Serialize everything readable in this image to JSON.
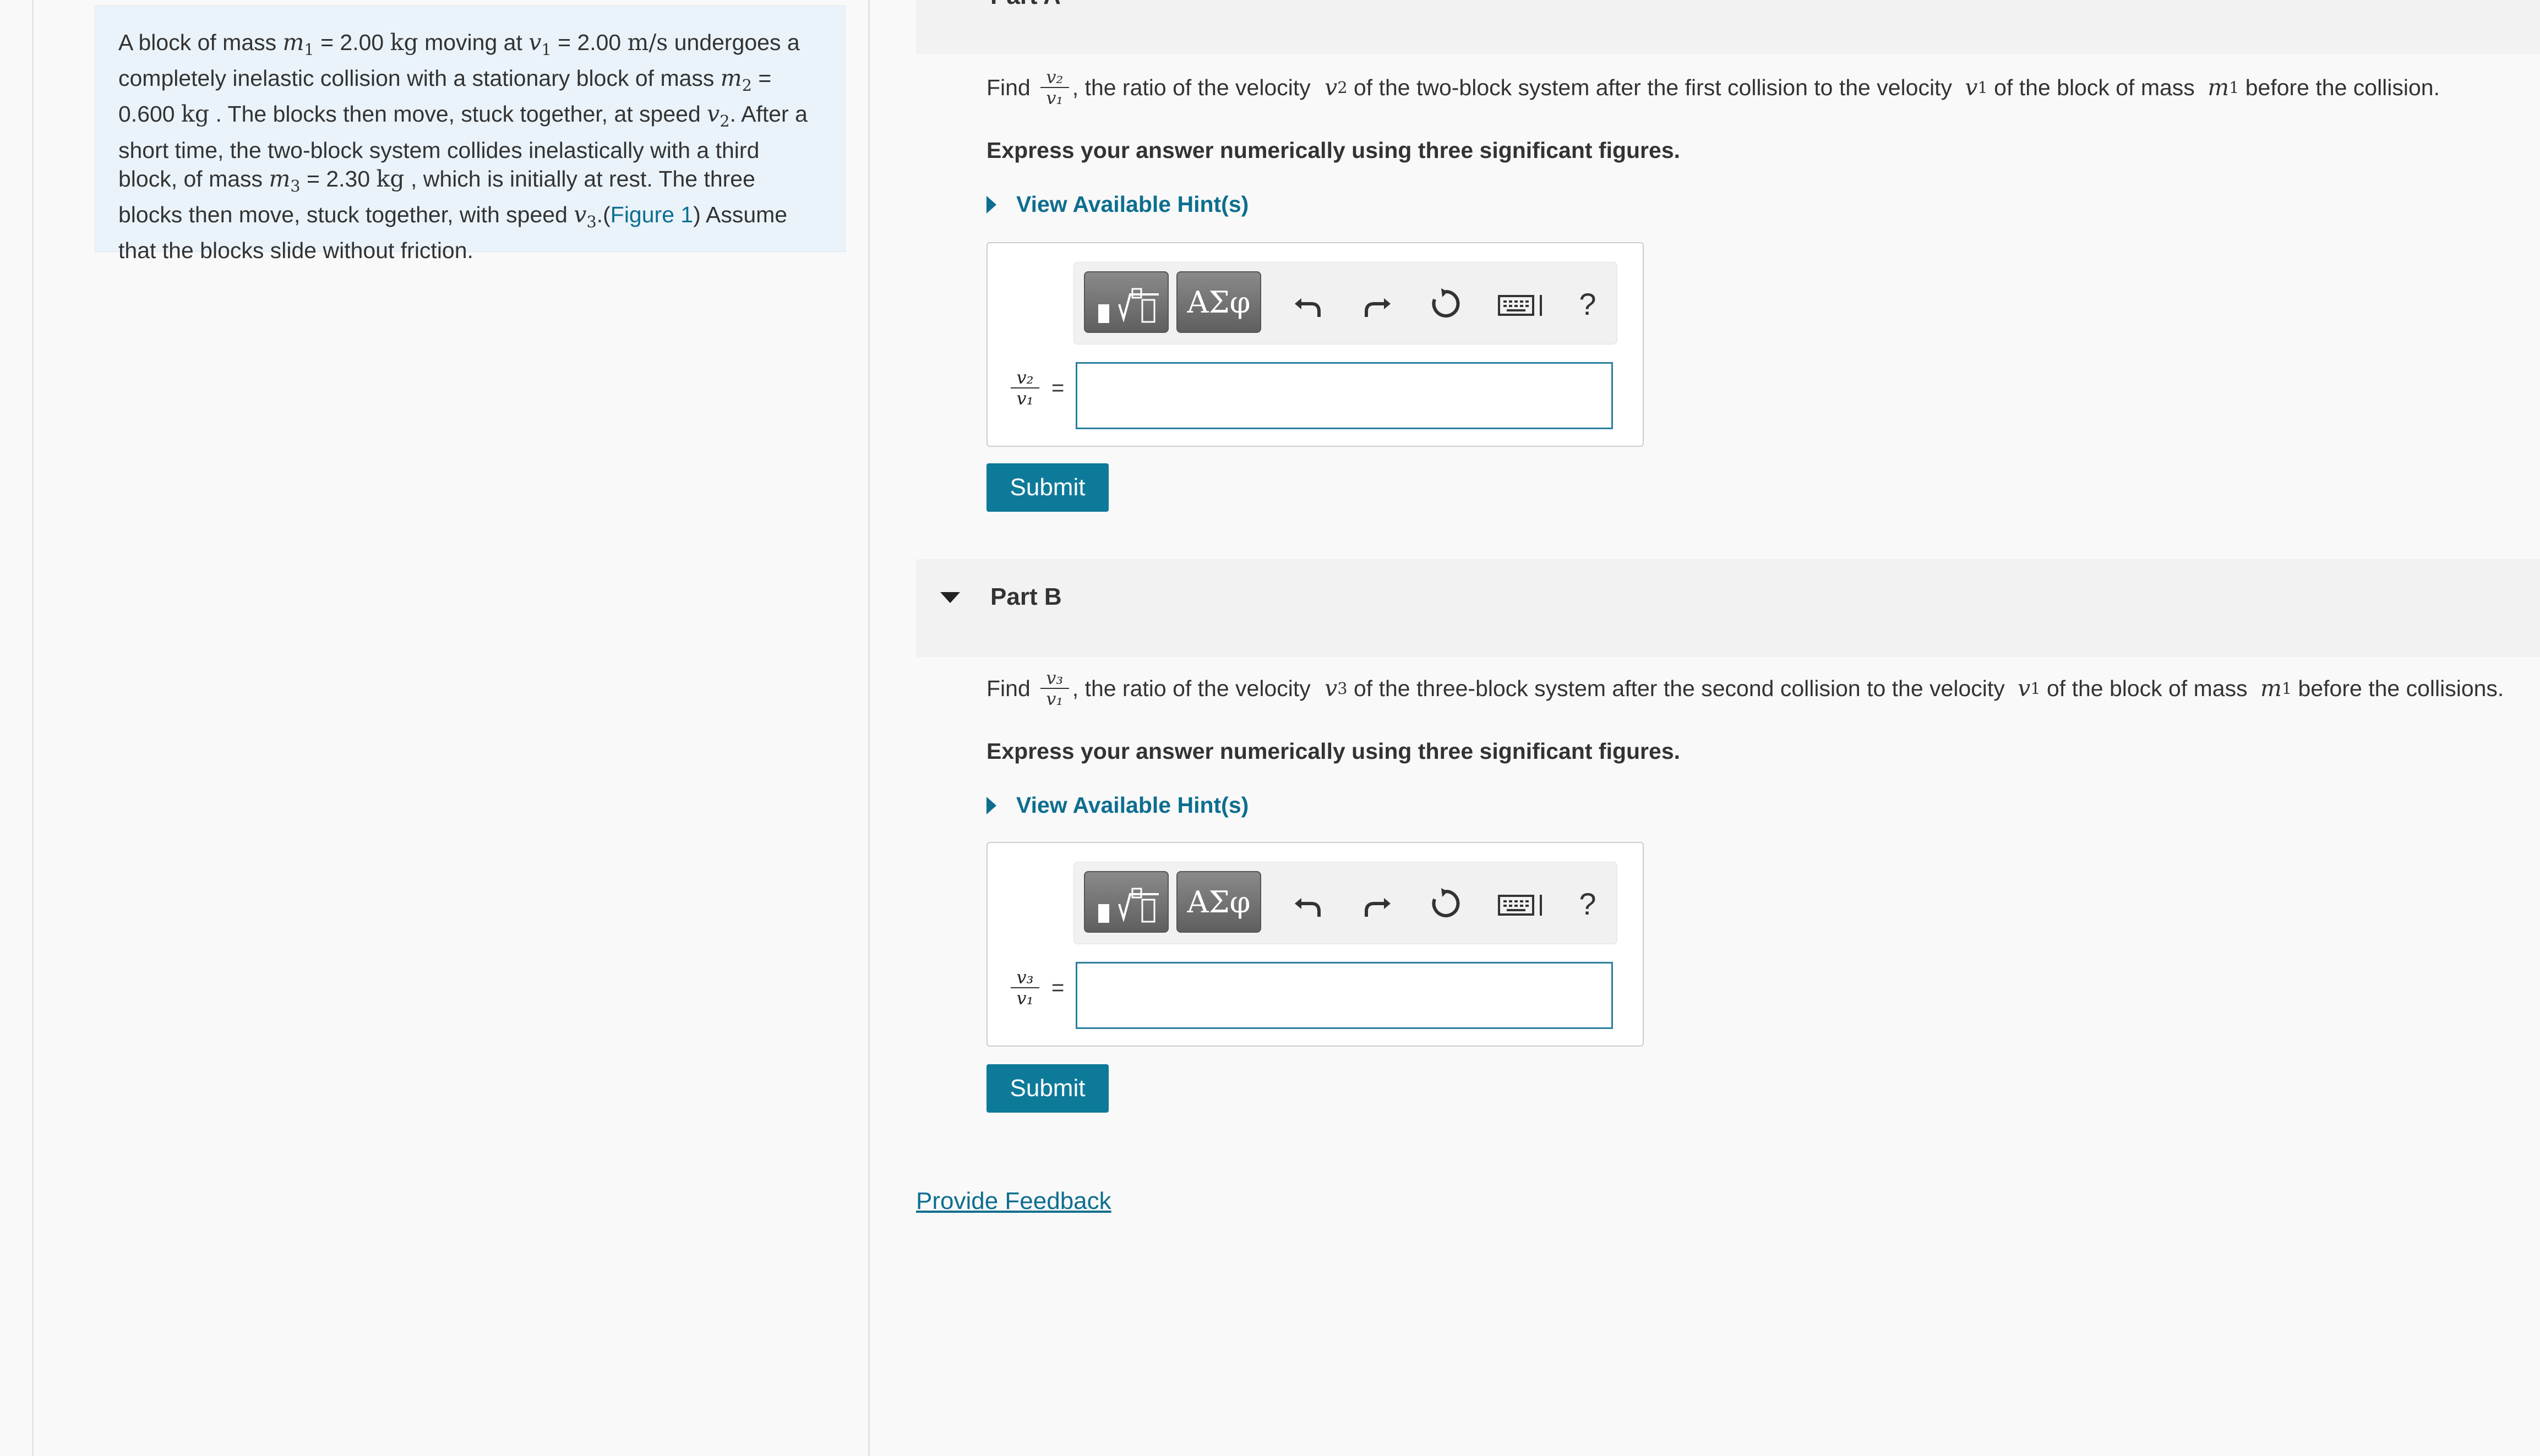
{
  "problem": {
    "t1": "A block of mass ",
    "m1": "m",
    "m1_sub": "1",
    "t2": " = 2.00 ",
    "kg1": "kg",
    "t3": " moving at ",
    "v1": "v",
    "v1_sub": "1",
    "t4": " = 2.00 ",
    "ms": "m/s",
    "t5": " undergoes a completely inelastic collision with a stationary block of mass ",
    "m2": "m",
    "m2_sub": "2",
    "t6": " = 0.600 ",
    "kg2": "kg",
    "t7": " . The blocks then move, stuck together, at speed ",
    "v2": "v",
    "v2_sub": "2",
    "t8": ". After a short time, the two-block system collides inelastically with a third block, of mass ",
    "m3": "m",
    "m3_sub": "3",
    "t9": " = 2.30 ",
    "kg3": "kg",
    "t10": " , which is initially at rest. The three blocks then move, stuck together, with speed ",
    "v3": "v",
    "v3_sub": "3",
    "t11": ".(",
    "figure_link": "Figure 1",
    "t12": ") Assume that the blocks slide without friction."
  },
  "parts": [
    {
      "title": "Part A",
      "question": {
        "find": "Find",
        "frac_num": "v₂",
        "frac_den": "v₁",
        "before": ", the ratio of the velocity ",
        "var1": "v",
        "var1_sub": "2",
        "mid": " of the two-block system after the first collision to the velocity ",
        "var2": "v",
        "var2_sub": "1",
        "mid2": " of the block of mass ",
        "var3": "m",
        "var3_sub": "1",
        "end": " before the collision."
      },
      "instruction": "Express your answer numerically using three significant figures.",
      "hint_label": "View Available Hint(s)",
      "lhs_num": "v₂",
      "lhs_den": "v₁",
      "equals": "=",
      "input_value": "",
      "submit_label": "Submit"
    },
    {
      "title": "Part B",
      "question": {
        "find": "Find",
        "frac_num": "v₃",
        "frac_den": "v₁",
        "before": ", the ratio of the velocity ",
        "var1": "v",
        "var1_sub": "3",
        "mid": " of the three-block system after the second collision to the velocity ",
        "var2": "v",
        "var2_sub": "1",
        "mid2": " of the block of mass ",
        "var3": "m",
        "var3_sub": "1",
        "end": " before the collisions."
      },
      "instruction": "Express your answer numerically using three significant figures.",
      "hint_label": "View Available Hint(s)",
      "lhs_num": "v₃",
      "lhs_den": "v₁",
      "equals": "=",
      "input_value": "",
      "submit_label": "Submit"
    }
  ],
  "toolbar": {
    "symbols_label": "ΑΣφ",
    "help_label": "?",
    "icons": [
      "templates-icon",
      "greek-symbols-icon",
      "undo-icon",
      "redo-icon",
      "reset-icon",
      "keyboard-icon",
      "help-icon"
    ]
  },
  "feedback_link": "Provide Feedback",
  "colors": {
    "accent": "#0e7a9a",
    "link": "#0d6e8f",
    "problem_bg": "#eaf3fa"
  }
}
